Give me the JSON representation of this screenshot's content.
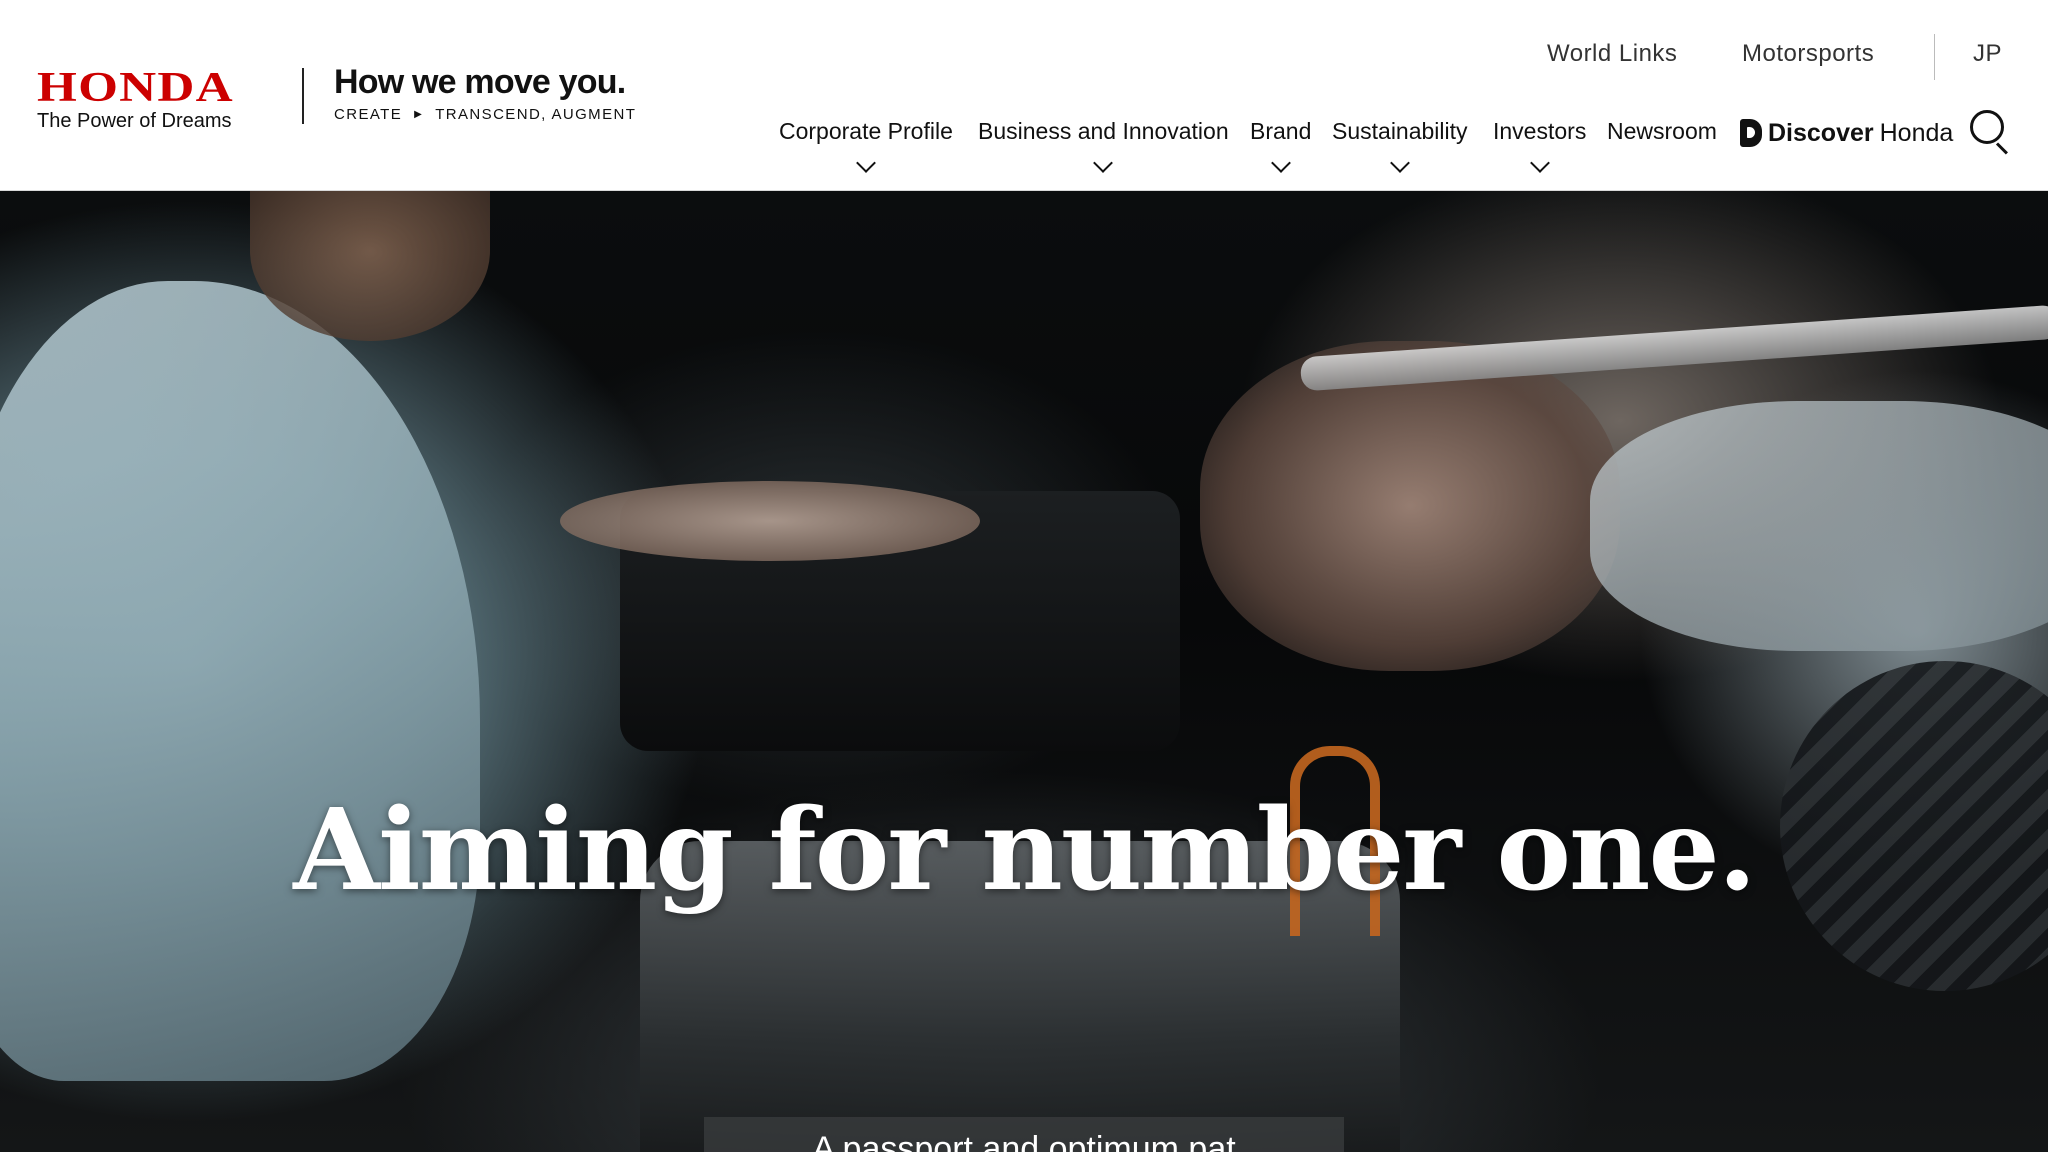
{
  "brand": {
    "logo_word": "HONDA",
    "logo_tagline": "The Power of Dreams",
    "slogan": "How we move you.",
    "slogan_sub_left": "CREATE",
    "slogan_sub_right": "TRANSCEND, AUGMENT",
    "logo_color": "#cc0000"
  },
  "utility_nav": [
    "World Links",
    "Motorsports",
    "JP"
  ],
  "main_nav": [
    {
      "label": "Corporate Profile",
      "has_dropdown": true
    },
    {
      "label": "Business and Innovation",
      "has_dropdown": true
    },
    {
      "label": "Brand",
      "has_dropdown": true
    },
    {
      "label": "Sustainability",
      "has_dropdown": true
    },
    {
      "label": "Investors",
      "has_dropdown": true
    },
    {
      "label": "Newsroom",
      "has_dropdown": false
    }
  ],
  "discover": {
    "strong": "Discover",
    "light": "Honda",
    "icon": "discover-honda-icon"
  },
  "search": {
    "icon": "search-icon"
  },
  "hero": {
    "heading": "Aiming for number one.",
    "caption": "A passport and optimum pat"
  }
}
